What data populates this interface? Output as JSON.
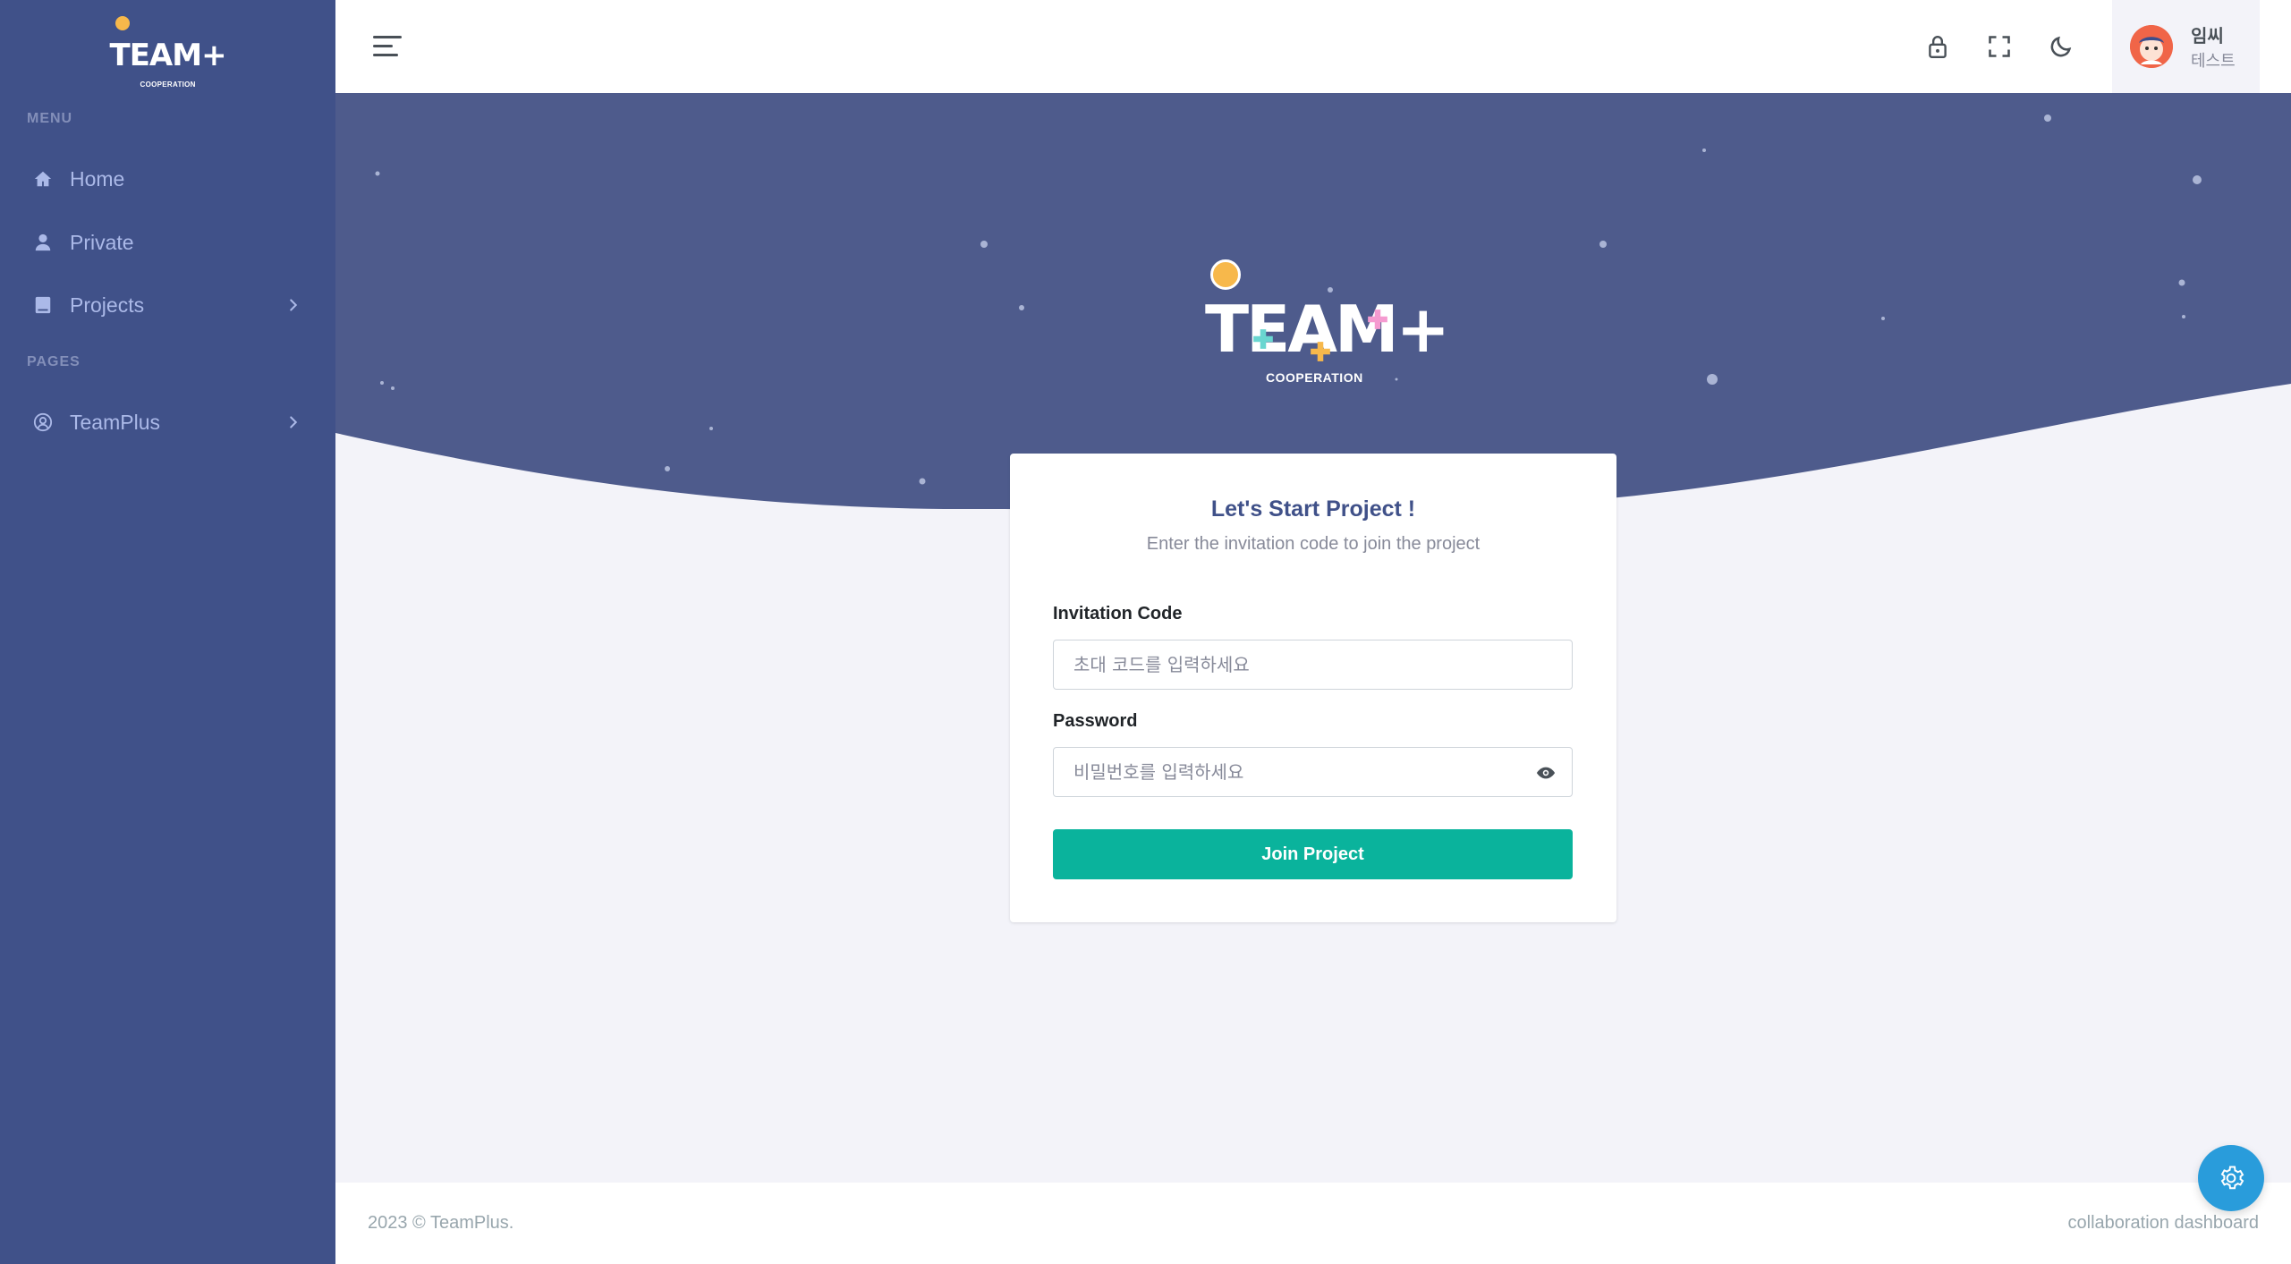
{
  "sidebar": {
    "logo_text": "TEAM+",
    "logo_sub": "COOPERATION",
    "menu_title": "MENU",
    "pages_title": "PAGES",
    "items": [
      {
        "label": "Home",
        "icon": "home-icon"
      },
      {
        "label": "Private",
        "icon": "user-icon"
      },
      {
        "label": "Projects",
        "icon": "book-icon"
      },
      {
        "label": "TeamPlus",
        "icon": "user-circle-icon"
      }
    ]
  },
  "topbar": {
    "icons": [
      "lock-icon",
      "fullscreen-icon",
      "moon-icon"
    ],
    "user": {
      "name": "임씨",
      "role": "테스트"
    }
  },
  "hero": {
    "logo_text": "TEAM+",
    "logo_sub": "COOPERATION"
  },
  "form": {
    "title": "Let's Start Project !",
    "subtitle": "Enter the invitation code to join the project",
    "code_label": "Invitation Code",
    "code_placeholder": "초대 코드를 입력하세요",
    "code_value": "",
    "password_label": "Password",
    "password_placeholder": "비밀번호를 입력하세요",
    "password_value": "",
    "submit_label": "Join Project"
  },
  "footer": {
    "left": "2023 © TeamPlus.",
    "right": "collaboration dashboard"
  },
  "colors": {
    "sidebar_bg": "#405189",
    "hero_bg": "#4e5b8c",
    "accent_green": "#0ab39c",
    "fab_blue": "#299cdb"
  }
}
